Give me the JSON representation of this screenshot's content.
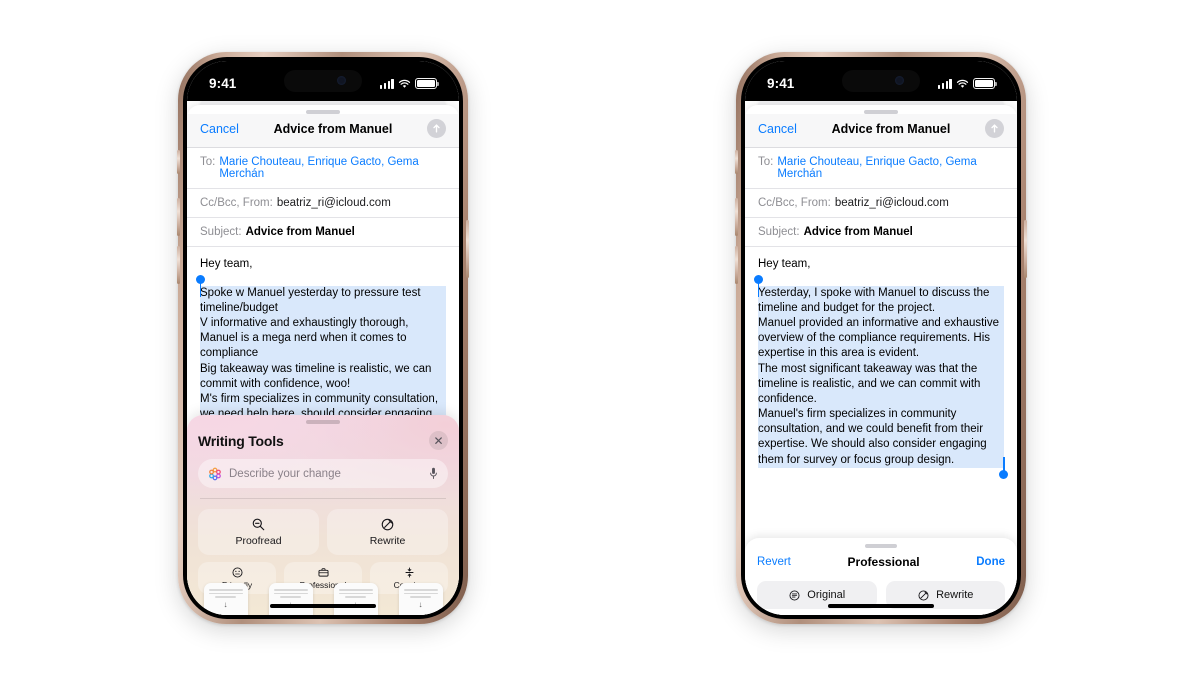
{
  "status_bar": {
    "time": "9:41",
    "signal_icon": "cellular-bars-icon",
    "wifi_icon": "wifi-icon",
    "battery_icon": "battery-full-icon"
  },
  "compose": {
    "cancel_label": "Cancel",
    "title": "Advice from Manuel",
    "send_icon": "send-arrow-up-icon",
    "to_label": "To:",
    "to_value": "Marie Chouteau, Enrique Gacto, Gema Merchán",
    "ccbcc_label": "Cc/Bcc, From:",
    "from_value": "beatriz_ri@icloud.com",
    "subject_label": "Subject:",
    "subject_value": "Advice from Manuel",
    "greeting": "Hey team,"
  },
  "left_phone": {
    "body_original": [
      "Spoke w Manuel yesterday to pressure test timeline/budget",
      "V informative and exhaustingly thorough, Manuel is a mega nerd when it comes to compliance",
      "Big takeaway was timeline is realistic, we can commit with confidence, woo!",
      "M's firm specializes in community consultation, we need help here, should consider engaging them for survey or focus group design"
    ],
    "writing_tools": {
      "title": "Writing Tools",
      "close_icon": "close-x-icon",
      "ai_icon": "apple-intelligence-icon",
      "search_placeholder": "Describe your change",
      "mic_icon": "microphone-icon",
      "primary_actions": [
        {
          "label": "Proofread",
          "icon": "magnifier-minus-icon"
        },
        {
          "label": "Rewrite",
          "icon": "pencil-circle-icon"
        }
      ],
      "tone_actions": [
        {
          "label": "Friendly",
          "icon": "smiley-face-icon"
        },
        {
          "label": "Professional",
          "icon": "briefcase-icon"
        },
        {
          "label": "Concise",
          "icon": "compress-arrows-icon"
        }
      ]
    },
    "keyboard_cards": [
      {
        "download_icon": "arrow-down-icon"
      },
      {
        "download_icon": "arrow-down-icon"
      },
      {
        "download_icon": "arrow-down-icon"
      },
      {
        "download_icon": "arrow-down-icon"
      }
    ]
  },
  "right_phone": {
    "body_rewritten": [
      "Yesterday, I spoke with Manuel to discuss the timeline and budget for the project.",
      "Manuel provided an informative and exhaustive overview of the compliance requirements. His expertise in this area is evident.",
      "The most significant takeaway was that the timeline is realistic, and we can commit with confidence.",
      "Manuel's firm specializes in community consultation, and we could benefit from their expertise. We should also consider engaging them for survey or focus group design."
    ],
    "rewrite_bar": {
      "revert_label": "Revert",
      "title": "Professional",
      "done_label": "Done",
      "buttons": [
        {
          "label": "Original",
          "icon": "original-text-icon"
        },
        {
          "label": "Rewrite",
          "icon": "pencil-circle-icon"
        }
      ]
    }
  },
  "colors": {
    "accent_blue": "#0a7cff",
    "selection_blue": "#d9e8fb",
    "panel_gradient_start": "#f0d9e6",
    "panel_gradient_end": "#f3e8d5"
  }
}
